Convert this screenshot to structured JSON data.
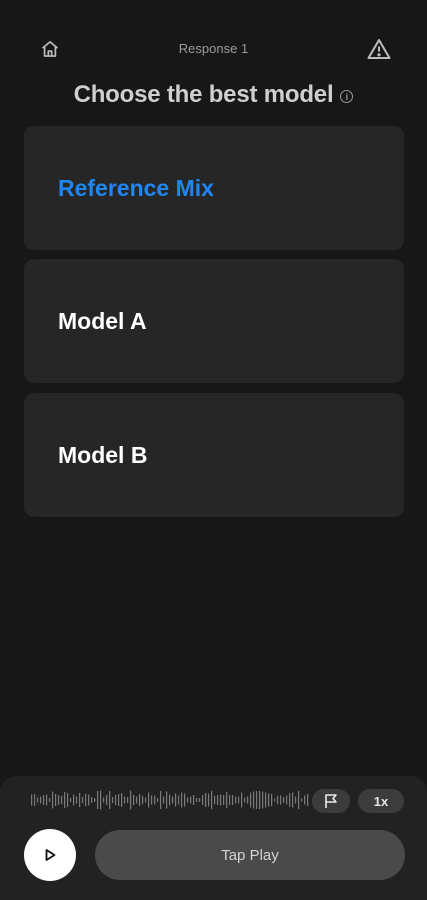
{
  "header": {
    "title": "Response 1",
    "home_icon": "home-icon",
    "warning_icon": "warning-icon"
  },
  "main": {
    "heading": "Choose the best model",
    "info_icon": "info-icon",
    "options": [
      {
        "label": "Reference Mix",
        "selected": true
      },
      {
        "label": "Model A",
        "selected": false
      },
      {
        "label": "Model B",
        "selected": false
      }
    ]
  },
  "player": {
    "waveform_icon": "waveform-icon",
    "flag_icon": "flag-icon",
    "speed": "1x",
    "play_icon": "play-icon",
    "action_label": "Tap Play"
  },
  "colors": {
    "background": "#171717",
    "card": "#262626",
    "accent": "#1f87f3",
    "player_bg": "#222222"
  }
}
